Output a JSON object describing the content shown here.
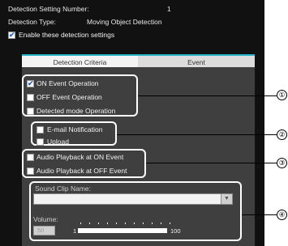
{
  "header": {
    "setting_number_label": "Detection Setting Number:",
    "setting_number_value": "1",
    "type_label": "Detection Type:",
    "type_value": "Moving Object Detection",
    "enable_label": "Enable these detection settings",
    "enable_checked": true
  },
  "tabs": [
    {
      "label": "Detection Criteria",
      "active": false
    },
    {
      "label": "Event",
      "active": true
    }
  ],
  "group1": {
    "items": [
      {
        "label": "ON Event Operation",
        "checked": true
      },
      {
        "label": "OFF Event Operation",
        "checked": false
      },
      {
        "label": "Detected mode Operation",
        "checked": false
      }
    ]
  },
  "group2": {
    "items": [
      {
        "label": "E-mail Notification",
        "checked": false
      },
      {
        "label": "Upload",
        "checked": false
      }
    ]
  },
  "group3": {
    "items": [
      {
        "label": "Audio Playback at ON Event",
        "checked": false
      },
      {
        "label": "Audio Playback at OFF Event",
        "checked": false
      }
    ]
  },
  "group4": {
    "sound_clip_label": "Sound Clip Name:",
    "sound_clip_value": "",
    "volume_label": "Volume:",
    "volume_value": "50",
    "slider_min": "1",
    "slider_max": "100"
  },
  "callouts": [
    "①",
    "②",
    "③",
    "④"
  ],
  "colors": {
    "panel_bg": "#111111",
    "content_bg": "#3f3f3f",
    "tab_accent": "#2bb3c9",
    "check_blue": "#2a62c9"
  }
}
